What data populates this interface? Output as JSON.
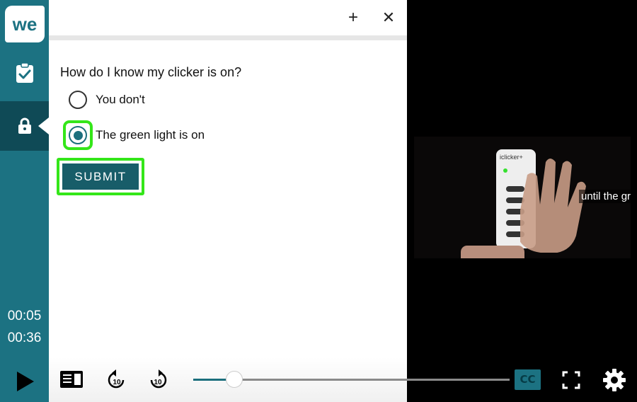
{
  "brand": {
    "logo_text": "we"
  },
  "sidebar": {
    "time_current": "00:05",
    "time_duration": "00:36"
  },
  "quiz": {
    "question": "How do I know my clicker is on?",
    "options": [
      {
        "label": "You don't",
        "selected": false
      },
      {
        "label": "The green light is on",
        "selected": true
      }
    ],
    "submit_label": "SUBMIT",
    "toolbar": {
      "expand_icon": "plus-icon",
      "close_icon": "close-icon"
    }
  },
  "video": {
    "subtitle": "until the gr",
    "device_label": "iclicker+"
  },
  "controls": {
    "cc_label": "CC",
    "rewind_label": "10",
    "forward_label": "10",
    "progress": 0.129,
    "icons": [
      "play-icon",
      "transcript-icon",
      "rewind-10-icon",
      "forward-10-icon",
      "cc-icon",
      "fullscreen-icon",
      "settings-gear-icon"
    ]
  },
  "colors": {
    "sidebar": "#1c7282",
    "sidebar_active": "#0f4a56",
    "submit": "#185d69",
    "focus_highlight": "#34e619"
  }
}
